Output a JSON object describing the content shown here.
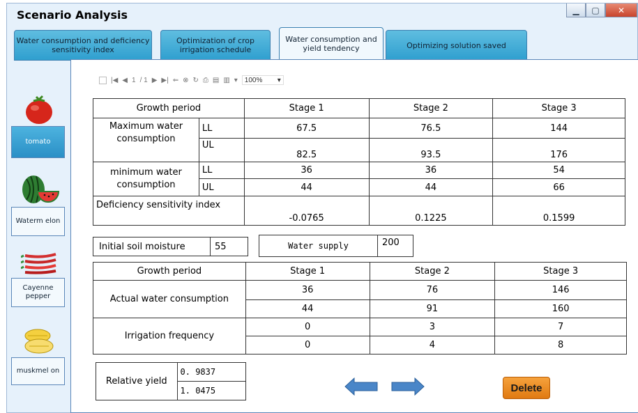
{
  "window": {
    "title": "Scenario Analysis"
  },
  "tabs": [
    {
      "label": "Water consumption  and deficiency sensitivity index"
    },
    {
      "label": "Optimization  of crop irrigation schedule"
    },
    {
      "label": "Water consumption and yield tendency"
    },
    {
      "label": "Optimizing solution saved"
    }
  ],
  "crops": [
    {
      "label": "tomato",
      "icon": "tomato-icon",
      "active": true
    },
    {
      "label": "Waterm elon",
      "icon": "watermelon-icon",
      "active": false
    },
    {
      "label": "Cayenne pepper",
      "icon": "cayenne-pepper-icon",
      "active": false
    },
    {
      "label": "muskmel on",
      "icon": "muskmelon-icon",
      "active": false
    }
  ],
  "toolbar": {
    "page_current": "1",
    "page_total": "/ 1",
    "zoom": "100%"
  },
  "table1": {
    "header": [
      "Growth period",
      "Stage 1",
      "Stage 2",
      "Stage 3"
    ],
    "max_label": "Maximum water consumption",
    "min_label": "minimum water consumption",
    "ll": "LL",
    "ul": "UL",
    "max_ll": [
      "67.5",
      "76.5",
      "144"
    ],
    "max_ul": [
      "82.5",
      "93.5",
      "176"
    ],
    "min_ll": [
      "36",
      "36",
      "54"
    ],
    "min_ul": [
      "44",
      "44",
      "66"
    ],
    "dsi_label": "Deficiency sensitivity index",
    "dsi": [
      "-0.0765",
      "0.1225",
      "0.1599"
    ]
  },
  "inputs": {
    "soil_label": "Initial soil moisture",
    "soil_value": "55",
    "supply_label": "Water supply",
    "supply_value": "200"
  },
  "table2": {
    "header": [
      "Growth period",
      "Stage 1",
      "Stage 2",
      "Stage 3"
    ],
    "awc_label": "Actual water consumption",
    "awc_row1": [
      "36",
      "76",
      "146"
    ],
    "awc_row2": [
      "44",
      "91",
      "160"
    ],
    "if_label": "Irrigation frequency",
    "if_row1": [
      "0",
      "3",
      "7"
    ],
    "if_row2": [
      "0",
      "4",
      "8"
    ]
  },
  "yield": {
    "label": "Relative yield",
    "v1": "0. 9837",
    "v2": "1. 0475"
  },
  "buttons": {
    "delete": "Delete"
  },
  "colors": {
    "tab_blue": "#2f9fcf",
    "arrow_blue": "#4a86c8",
    "delete_orange": "#e88a1e"
  }
}
